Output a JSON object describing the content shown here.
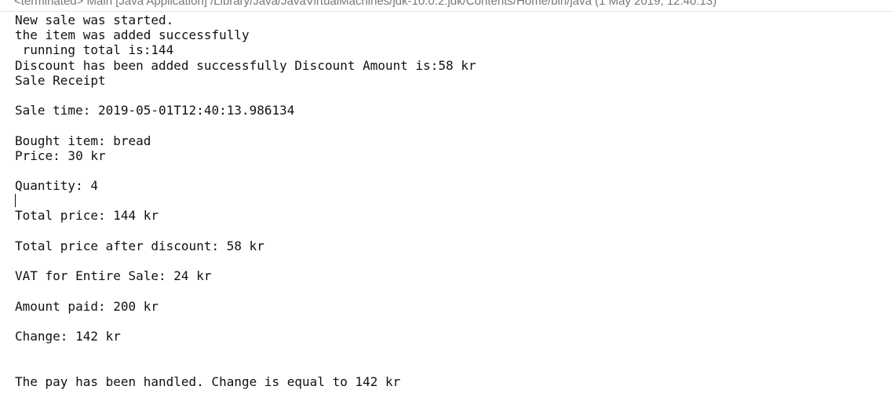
{
  "console": {
    "header": "<terminated> Main [Java Application] /Library/Java/JavaVirtualMachines/jdk-10.0.2.jdk/Contents/Home/bin/java (1 May 2019, 12:40:13)",
    "lines": [
      "New sale was started.",
      "the item was added successfully",
      " running total is:144",
      "Discount has been added successfully Discount Amount is:58 kr",
      "Sale Receipt",
      "",
      "Sale time: 2019-05-01T12:40:13.986134",
      "",
      "Bought item: bread",
      "Price: 30 kr",
      "",
      "Quantity: 4",
      "",
      "Total price: 144 kr",
      "",
      "Total price after discount: 58 kr",
      "",
      "VAT for Entire Sale: 24 kr",
      "",
      "Amount paid: 200 kr",
      "",
      "Change: 142 kr",
      "",
      "",
      "The pay has been handled. Change is equal to 142 kr"
    ]
  }
}
